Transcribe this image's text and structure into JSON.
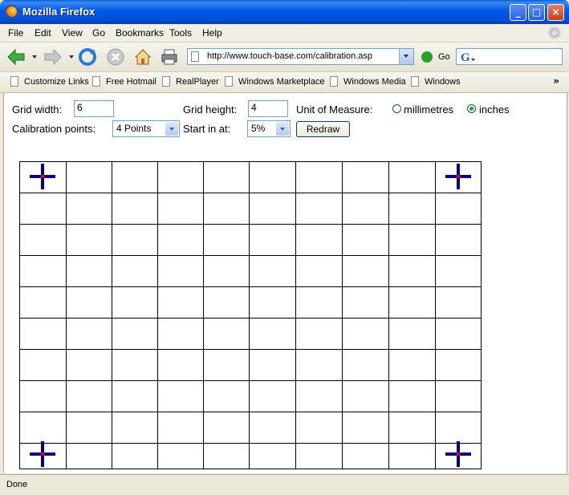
{
  "window": {
    "title": "Mozilla Firefox"
  },
  "menu": [
    "File",
    "Edit",
    "View",
    "Go",
    "Bookmarks",
    "Tools",
    "Help"
  ],
  "nav": {
    "url": "http://www.touch-base.com/calibration.asp",
    "go_label": "Go",
    "search_engine_icon": "google-icon"
  },
  "bookmarks": [
    "Customize Links",
    "Free Hotmail",
    "RealPlayer",
    "Windows Marketplace",
    "Windows Media",
    "Windows"
  ],
  "form": {
    "grid_width_label": "Grid width:",
    "grid_width_value": "6",
    "grid_height_label": "Grid height:",
    "grid_height_value": "4",
    "unit_label": "Unit of Measure:",
    "unit_options": [
      "millimetres",
      "inches"
    ],
    "unit_selected": "inches",
    "calib_label": "Calibration points:",
    "calib_value": "4 Points",
    "start_label": "Start in at:",
    "start_value": "5%",
    "redraw_label": "Redraw"
  },
  "grid": {
    "columns": 10,
    "rows": 10,
    "calibration_points": 4,
    "crosshair_color": "#00008b",
    "center_color": "#e00000"
  },
  "status": {
    "text": "Done"
  }
}
